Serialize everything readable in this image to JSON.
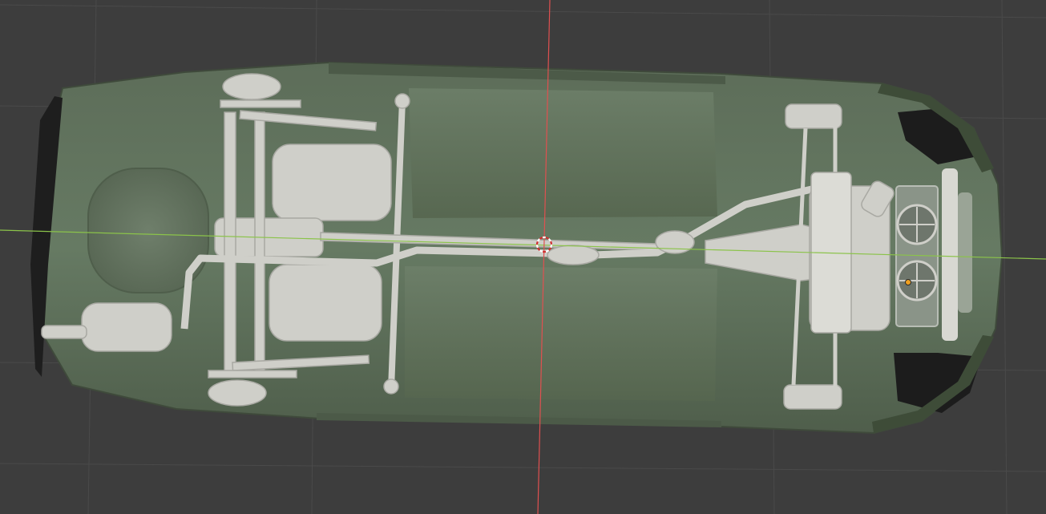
{
  "viewport": {
    "background": "#3d3d3d",
    "grid_color": "#4a4a4a",
    "axis_x_color": "#8bc34a",
    "axis_y_color": "#e05050"
  },
  "scene": {
    "object": "car-underbody-model",
    "body_color": "#5b6b58",
    "body_dark_color": "#46543f",
    "parts_color": "#cfcfc9",
    "tire_color": "#1c1c1c",
    "origin_marker_color": "#f0a020"
  },
  "cursor": {
    "icon": "3d-cursor-icon",
    "ring_color_a": "#ffffff",
    "ring_color_b": "#d03030"
  }
}
